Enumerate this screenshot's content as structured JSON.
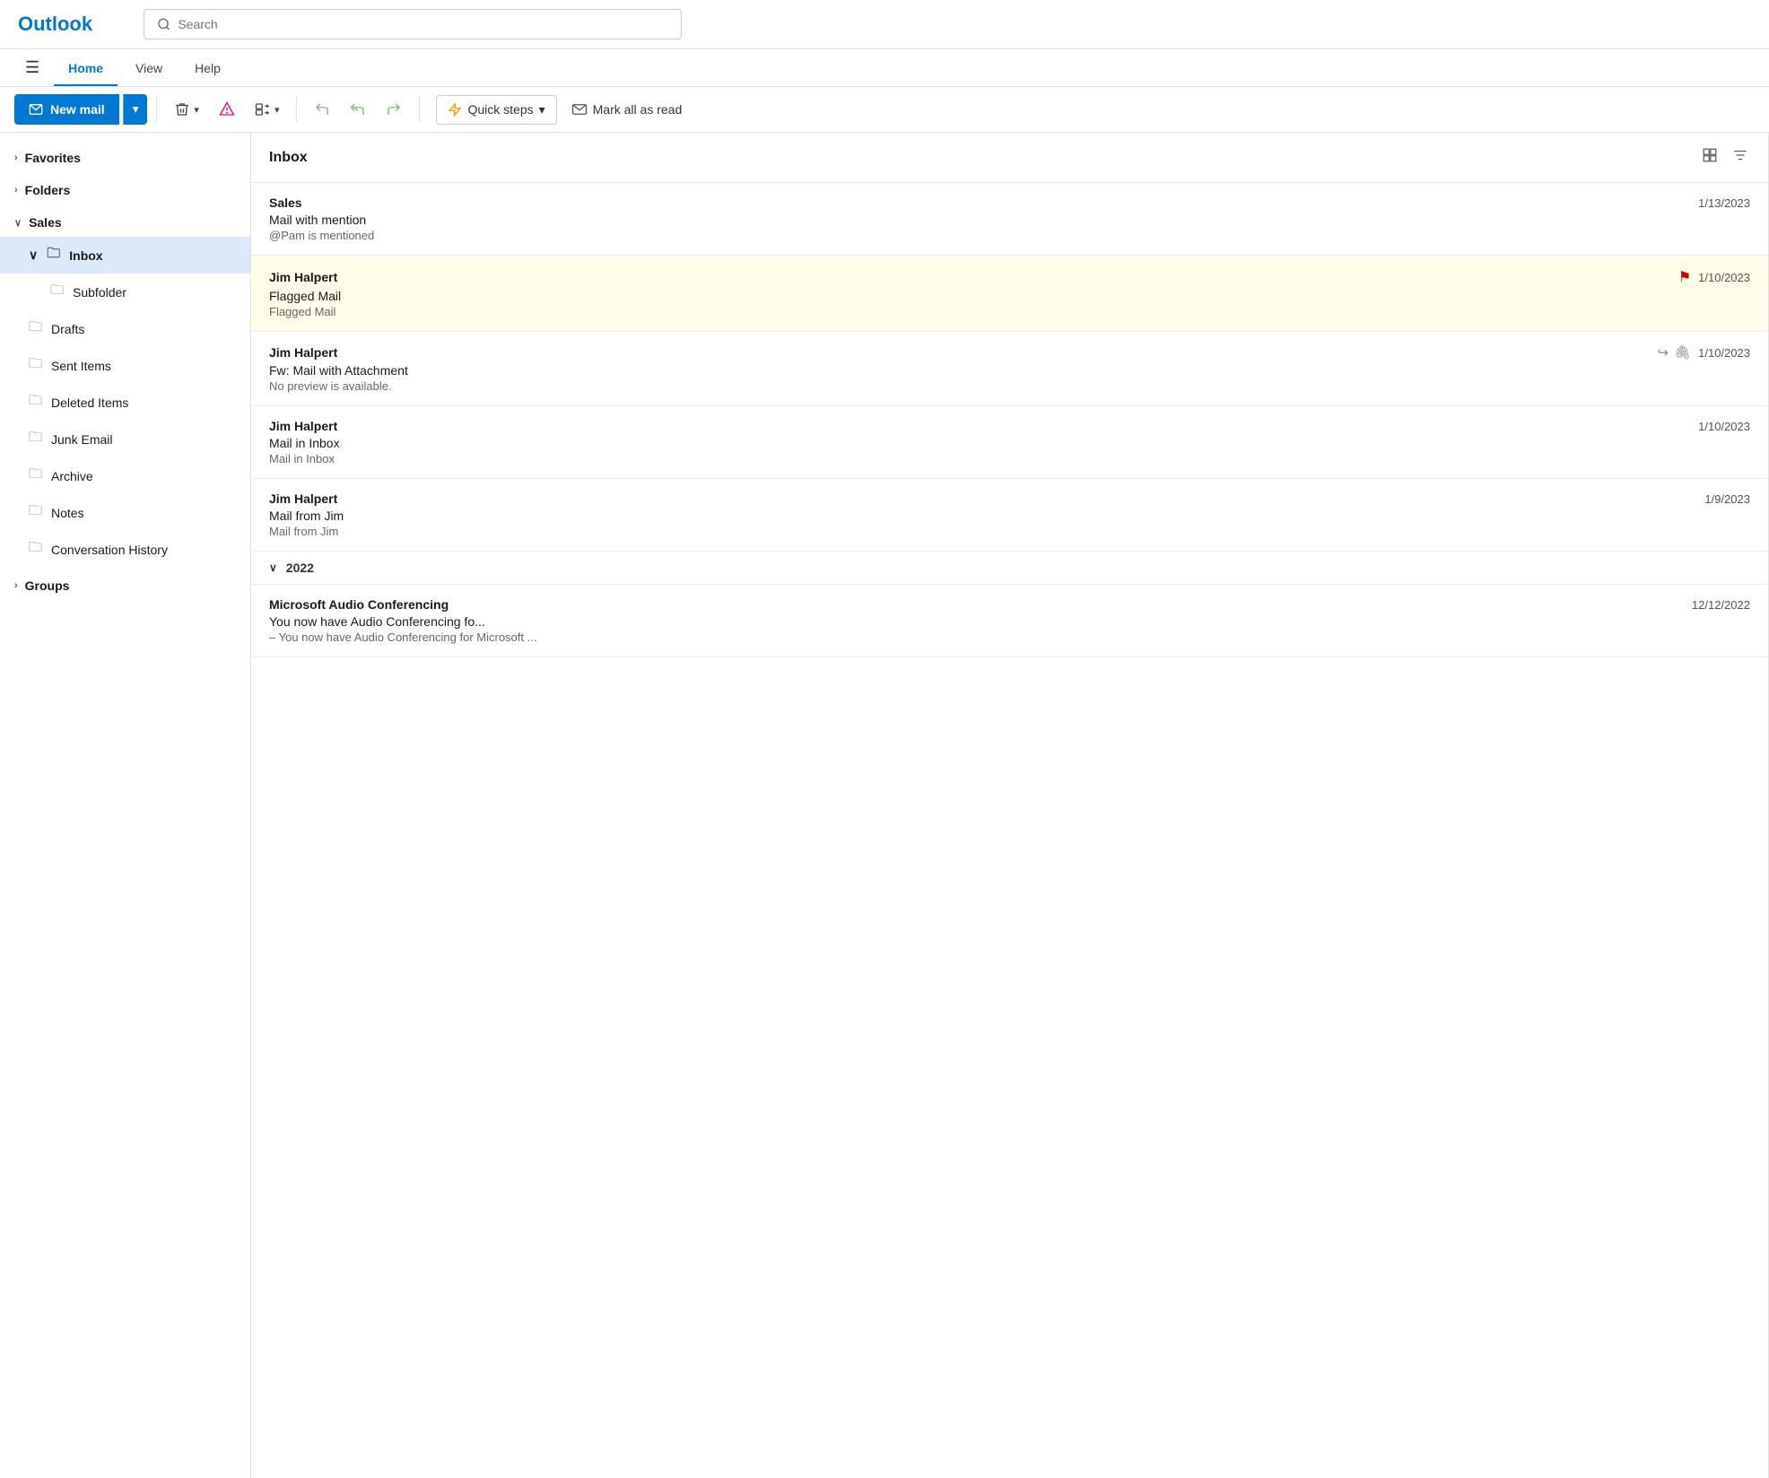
{
  "header": {
    "logo": "Outlook",
    "search_placeholder": "Search"
  },
  "nav": {
    "hamburger": "☰",
    "tabs": [
      {
        "label": "Home",
        "active": true
      },
      {
        "label": "View",
        "active": false
      },
      {
        "label": "Help",
        "active": false
      }
    ]
  },
  "toolbar": {
    "new_mail_label": "New mail",
    "dropdown_arrow": "▾",
    "delete_tooltip": "Delete",
    "report_tooltip": "Report",
    "move_tooltip": "Move",
    "reply_tooltip": "Reply",
    "reply_all_tooltip": "Reply All",
    "forward_tooltip": "Forward",
    "quick_steps_label": "Quick steps",
    "quick_steps_arrow": "▾",
    "mark_all_label": "Mark all as read"
  },
  "sidebar": {
    "favorites_label": "Favorites",
    "folders_label": "Folders",
    "sales_label": "Sales",
    "inbox_label": "Inbox",
    "subfolder_label": "Subfolder",
    "drafts_label": "Drafts",
    "sent_items_label": "Sent Items",
    "deleted_items_label": "Deleted Items",
    "junk_email_label": "Junk Email",
    "archive_label": "Archive",
    "notes_label": "Notes",
    "conversation_history_label": "Conversation History",
    "groups_label": "Groups"
  },
  "inbox": {
    "title": "Inbox",
    "emails": [
      {
        "sender": "Sales",
        "subject": "Mail with mention",
        "preview": "@Pam is mentioned",
        "date": "1/13/2023",
        "flagged": false,
        "forwarded": false,
        "has_attachment": false
      },
      {
        "sender": "Jim Halpert",
        "subject": "Flagged Mail",
        "preview": "Flagged Mail",
        "date": "1/10/2023",
        "flagged": true,
        "forwarded": false,
        "has_attachment": false
      },
      {
        "sender": "Jim Halpert",
        "subject": "Fw: Mail with Attachment",
        "preview": "No preview is available.",
        "date": "1/10/2023",
        "flagged": false,
        "forwarded": true,
        "has_attachment": true
      },
      {
        "sender": "Jim Halpert",
        "subject": "Mail in Inbox",
        "preview": "Mail in Inbox",
        "date": "1/10/2023",
        "flagged": false,
        "forwarded": false,
        "has_attachment": false
      },
      {
        "sender": "Jim Halpert",
        "subject": "Mail from Jim",
        "preview": "Mail from Jim",
        "date": "1/9/2023",
        "flagged": false,
        "forwarded": false,
        "has_attachment": false
      }
    ],
    "year_divider": "2022",
    "year_emails": [
      {
        "sender": "Microsoft Audio Conferencing",
        "subject": "You now have Audio Conferencing fo...",
        "preview": "– You now have Audio Conferencing for Microsoft ...",
        "date": "12/12/2022",
        "flagged": false,
        "forwarded": false,
        "has_attachment": false
      }
    ]
  }
}
